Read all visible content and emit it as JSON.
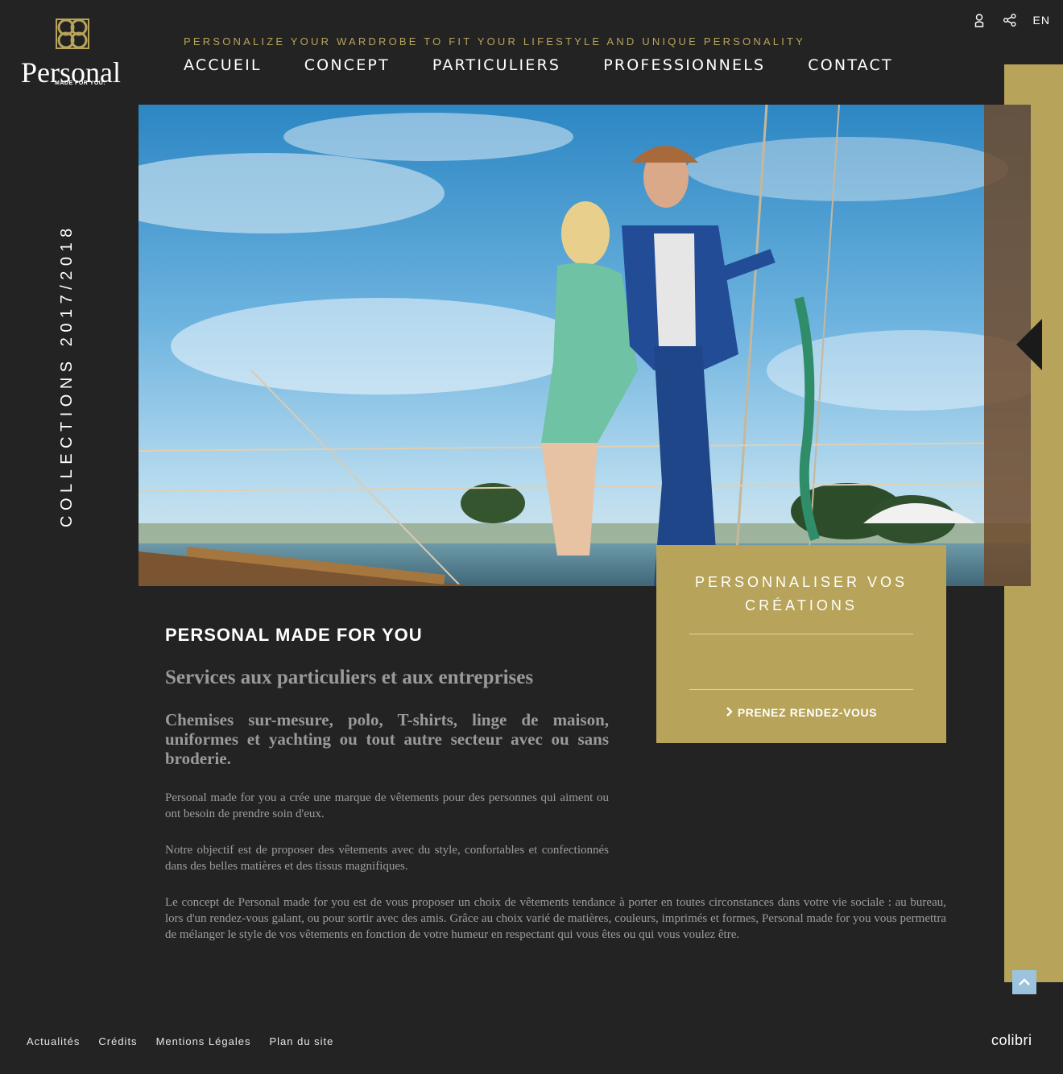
{
  "header": {
    "logo_wordmark": "Personal",
    "logo_tagline": "MADE FOR YOU.",
    "tagline": "PERSONALIZE YOUR WARDROBE TO FIT YOUR LIFESTYLE AND UNIQUE PERSONALITY",
    "nav": [
      "ACCUEIL",
      "CONCEPT",
      "PARTICULIERS",
      "PROFESSIONNELS",
      "CONTACT"
    ],
    "icons": [
      "user-icon",
      "share-icon"
    ],
    "lang": "EN"
  },
  "side_label": "COLLECTIONS 2017/2018",
  "cta": {
    "title_line1": "PERSONNALISER VOS",
    "title_line2": "CRÉATIONS",
    "link": "PRENEZ RENDEZ-VOUS",
    "icon": "chevron-right-icon"
  },
  "content": {
    "heading": "PERSONAL MADE FOR YOU",
    "subheading": "Services aux particuliers et aux entreprises",
    "services": "Chemises sur-mesure, polo, T-shirts, linge de maison, uniformes et yachting ou tout autre secteur avec ou sans broderie.",
    "p1": "Personal made for you  a crée une marque de vêtements pour des personnes qui aiment ou ont besoin de prendre soin d'eux.",
    "p2": "Notre objectif est de proposer des vêtements avec du style, confortables et  confectionnés dans des belles matières et des tissus magnifiques.",
    "p3": "Le concept de Personal made for you est de vous proposer un  choix de vêtements tendance à porter en toutes circonstances dans votre vie sociale : au bureau, lors d'un rendez-vous galant, ou pour sortir avec des amis. Grâce au choix varié de matières, couleurs, imprimés et formes, Personal made for you vous permettra de mélanger le style de vos vêtements en fonction de votre humeur en respectant qui vous êtes ou qui  vous voulez être."
  },
  "footer": {
    "links": [
      "Actualités",
      "Crédits",
      "Mentions Légales",
      "Plan du site"
    ],
    "brand": "colibri"
  },
  "colors": {
    "background": "#232323",
    "gold": "#b7a45a",
    "scroll_top": "#9bc3dc"
  }
}
